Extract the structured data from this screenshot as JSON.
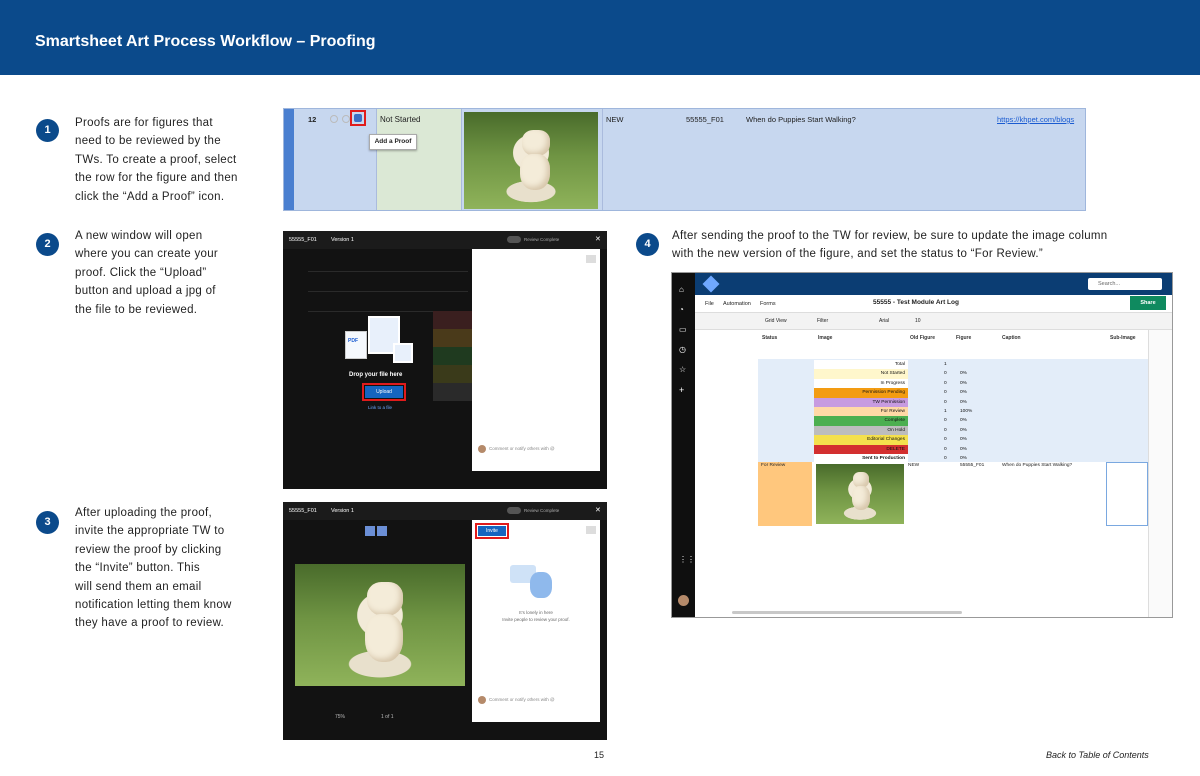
{
  "header": {
    "title": "Smartsheet Art Process Workflow – Proofing"
  },
  "steps": [
    {
      "num": "1",
      "text": "Proofs are for figures that\nneed to be reviewed by the\nTWs. To create a proof, select\nthe row for the figure and then\nclick the “Add a Proof” icon."
    },
    {
      "num": "2",
      "text": "A new window will open\nwhere you can create your\nproof. Click the “Upload”\nbutton and upload a jpg of\nthe file to be reviewed."
    },
    {
      "num": "3",
      "text": "After uploading the proof,\ninvite the appropriate TW to\nreview the proof by clicking\nthe “Invite” button. This\nwill send them an email\nnotification letting them know\nthey have a proof to review."
    },
    {
      "num": "4",
      "text": "After sending the proof to the TW for review, be sure to update the image column\nwith the new version of the figure, and set the status to “For Review.”"
    }
  ],
  "shot1": {
    "row_number": "12",
    "status": "Not Started",
    "tooltip": "Add a Proof",
    "old_figure": "NEW",
    "figure": "55555_F01",
    "caption": "When do Puppies Start Walking?",
    "link": "https://khpet.com/blogs"
  },
  "shot2": {
    "file": "55555_F01",
    "version": "Version 1",
    "toggle_label": "Review Complete",
    "drop_text": "Drop your file here",
    "upload": "Upload",
    "link_file": "Link to a file",
    "pdf_label": "PDF",
    "comment_placeholder": "Comment or notify others with @"
  },
  "shot3": {
    "file": "55555_F01",
    "version": "Version 1",
    "toggle_label": "Review Complete",
    "invite": "Invite",
    "empty_line1": "It’s lonely in here",
    "empty_line2": "Invite people to review your proof.",
    "zoom": "75%",
    "pages": "1 of 1",
    "comment_placeholder": "Comment or notify others with @"
  },
  "shot4": {
    "search": "Search...",
    "menu": [
      "File",
      "Automation",
      "Forms"
    ],
    "sheet_title": "55555 - Test Module Art Log",
    "share": "Share",
    "toolbar": {
      "view": "Grid View",
      "filter": "Filter",
      "font": "Arial",
      "size": "10"
    },
    "columns": [
      "Status",
      "Image",
      "Old Figure",
      "Figure",
      "Caption",
      "Sub-Image"
    ],
    "summary": [
      {
        "label": "Total",
        "a": "1",
        "b": "",
        "color": "#ffffff"
      },
      {
        "label": "Not Started",
        "a": "0",
        "b": "0%",
        "color": "#fff7cc"
      },
      {
        "label": "In Progress",
        "a": "0",
        "b": "0%",
        "color": "#ffffff"
      },
      {
        "label": "Permission Pending",
        "a": "0",
        "b": "0%",
        "color": "#f39c12"
      },
      {
        "label": "TW Permission",
        "a": "0",
        "b": "0%",
        "color": "#c79be0"
      },
      {
        "label": "For Review",
        "a": "1",
        "b": "100%",
        "color": "#ffd9a6"
      },
      {
        "label": "Complete",
        "a": "0",
        "b": "0%",
        "color": "#4caf50"
      },
      {
        "label": "On Hold",
        "a": "0",
        "b": "0%",
        "color": "#bdbdbd"
      },
      {
        "label": "Editorial Changes",
        "a": "0",
        "b": "0%",
        "color": "#f4e04d"
      },
      {
        "label": "DELETE",
        "a": "0",
        "b": "0%",
        "color": "#d32f2f"
      },
      {
        "label": "Sent to Production",
        "a": "0",
        "b": "0%",
        "color": "#ffffff"
      }
    ],
    "row": {
      "status": "For Review",
      "old_figure": "NEW",
      "figure": "55555_F01",
      "caption": "When do Puppies Start Walking?"
    }
  },
  "footer": {
    "page": "15",
    "toc": "Back to Table of Contents"
  }
}
